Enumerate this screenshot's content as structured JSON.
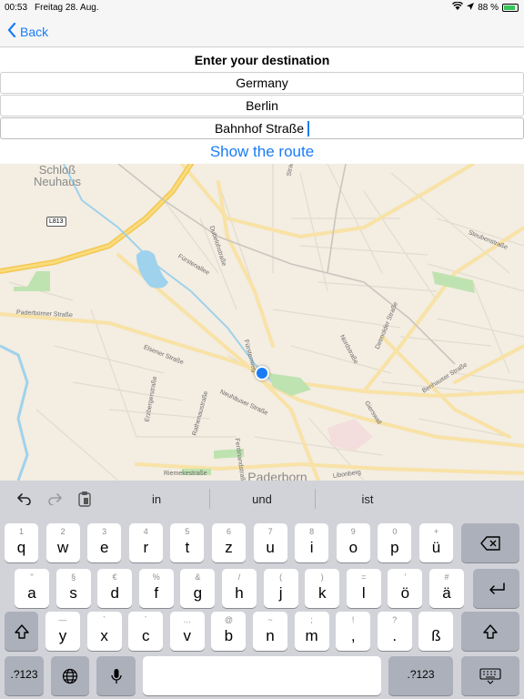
{
  "status_bar": {
    "time": "00:53",
    "date": "Freitag 28. Aug.",
    "battery": "88 %",
    "battery_level": 0.88
  },
  "nav": {
    "back_label": "Back"
  },
  "form": {
    "title": "Enter your destination",
    "country": "Germany",
    "city": "Berlin",
    "street": "Bahnhof Straße",
    "route_button": "Show the route"
  },
  "map": {
    "labels": {
      "town_top": "Schloß\nNeuhaus",
      "town_bottom": "Paderborn",
      "road_shield": "L813",
      "paderborner": "Paderborner Straße",
      "fuerstenallee": "Fürstenallee",
      "dubelohstrasse": "Dubelohstraße",
      "elsener": "Elsener Straße",
      "neuhauser": "Neuhäuser Straße",
      "neuhauser2": "Neuhäuser Straße",
      "erzberger": "Erzbergerstraße",
      "ferdinand": "Ferdinandstraße",
      "rathenau": "Rathenaustraße",
      "riemeke": "Riemekestraße",
      "fuerstenweg": "Fürstenweg",
      "nordstrasse": "Nordstraße",
      "detmolder": "Detmolder Straße",
      "steubenstrasse": "Steubenstraße",
      "benhauser": "Benhauser Straße",
      "gierswall": "Gierswall",
      "liboriberg": "Liboriberg",
      "top_strasse": "Straße"
    }
  },
  "suggestions": [
    "in",
    "und",
    "ist"
  ],
  "keyboard": {
    "row1": [
      {
        "alt": "1",
        "main": "q"
      },
      {
        "alt": "2",
        "main": "w"
      },
      {
        "alt": "3",
        "main": "e"
      },
      {
        "alt": "4",
        "main": "r"
      },
      {
        "alt": "5",
        "main": "t"
      },
      {
        "alt": "6",
        "main": "z"
      },
      {
        "alt": "7",
        "main": "u"
      },
      {
        "alt": "8",
        "main": "i"
      },
      {
        "alt": "9",
        "main": "o"
      },
      {
        "alt": "0",
        "main": "p"
      },
      {
        "alt": "+",
        "main": "ü"
      }
    ],
    "row2": [
      {
        "alt": "\"",
        "main": "a"
      },
      {
        "alt": "§",
        "main": "s"
      },
      {
        "alt": "€",
        "main": "d"
      },
      {
        "alt": "%",
        "main": "f"
      },
      {
        "alt": "&",
        "main": "g"
      },
      {
        "alt": "/",
        "main": "h"
      },
      {
        "alt": "(",
        "main": "j"
      },
      {
        "alt": ")",
        "main": "k"
      },
      {
        "alt": "=",
        "main": "l"
      },
      {
        "alt": "'",
        "main": "ö"
      },
      {
        "alt": "#",
        "main": "ä"
      }
    ],
    "row3": [
      {
        "alt": "—",
        "main": "y"
      },
      {
        "alt": "`",
        "main": "x"
      },
      {
        "alt": "´",
        "main": "c"
      },
      {
        "alt": "…",
        "main": "v"
      },
      {
        "alt": "@",
        "main": "b"
      },
      {
        "alt": "~",
        "main": "n"
      },
      {
        "alt": ";",
        "main": "m"
      },
      {
        "alt": "!",
        "main": ","
      },
      {
        "alt": "?",
        "main": "."
      },
      {
        "alt": "",
        "main": "ß"
      }
    ],
    "numbers_label": ".?123"
  }
}
